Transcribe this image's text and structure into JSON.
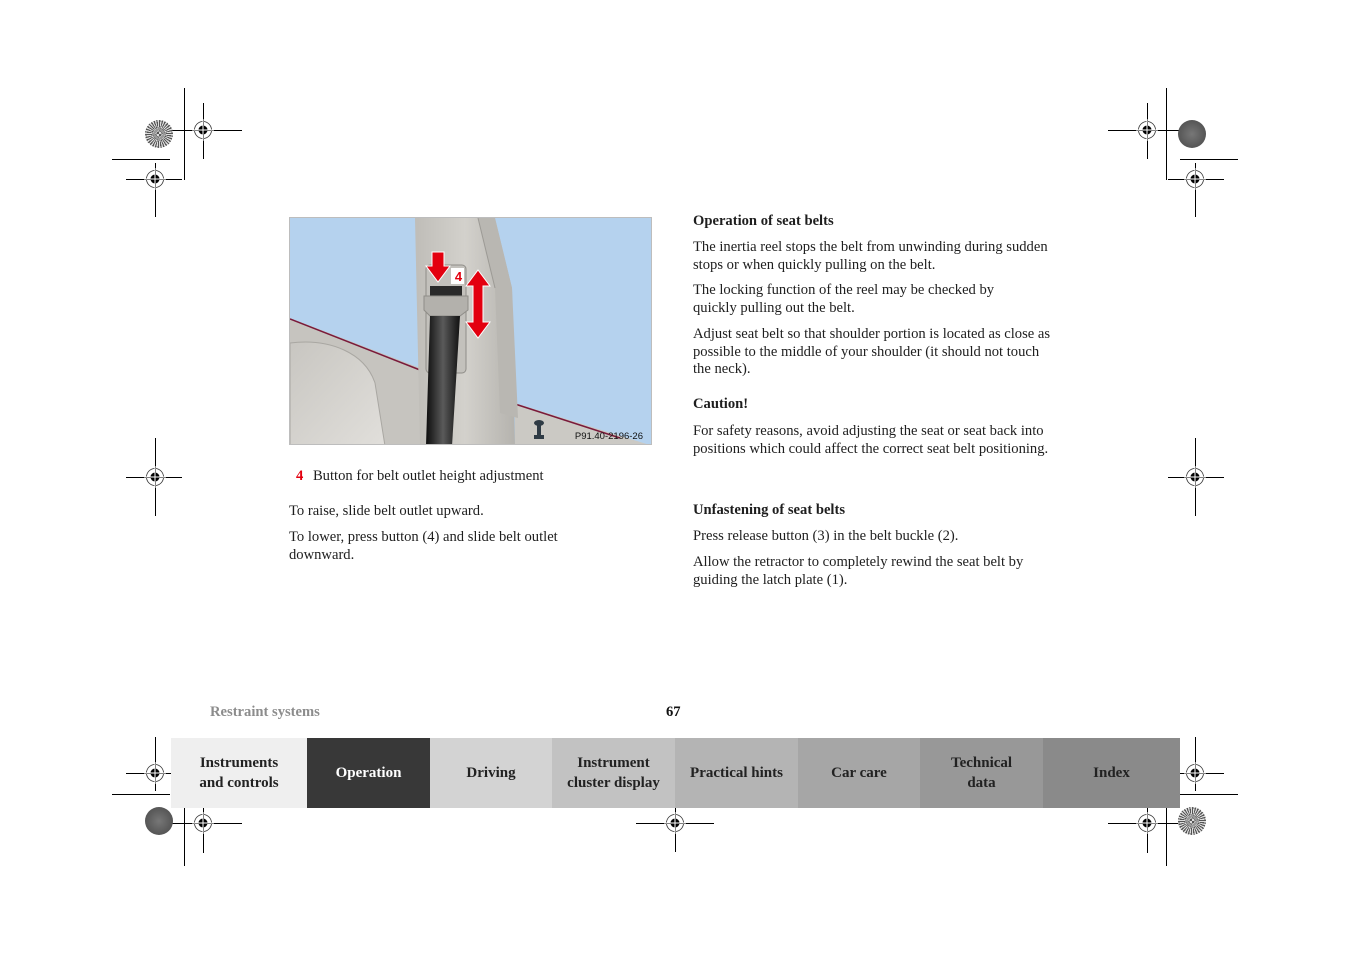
{
  "figure": {
    "callout_number": "4",
    "image_code": "P91.40-2196-26",
    "colors": {
      "sky": "#b5d2ee",
      "pillar": "#c9c7c2",
      "arrow": "#e3000f",
      "belt": "#151515"
    }
  },
  "left_column": {
    "legend": {
      "number": "4",
      "text": "Button for belt outlet height adjustment"
    },
    "paragraphs": [
      "To raise, slide belt outlet upward.",
      "To lower, press button (4) and slide belt outlet downward."
    ]
  },
  "right_column": {
    "section1": {
      "heading": "Operation of seat belts",
      "paragraphs": [
        "The inertia reel stops the belt from unwinding during sudden stops or when quickly pulling on the belt.",
        "The locking function of the reel may be checked by quickly pulling out the belt.",
        "Adjust seat belt so that shoulder portion is located as close as possible to the middle of your shoulder (it should not touch the neck)."
      ]
    },
    "caution": {
      "heading": "Caution!",
      "text": "For safety reasons, avoid adjusting the seat or seat back into positions which could affect the correct seat belt positioning."
    },
    "section2": {
      "heading": "Unfastening of seat belts",
      "paragraphs": [
        "Press release button (3) in the belt buckle (2).",
        "Allow the retractor to completely rewind the seat belt by guiding the latch plate (1)."
      ]
    }
  },
  "footer": {
    "section_title": "Restraint systems",
    "page_number": "67"
  },
  "nav_tabs": [
    {
      "line1": "Instruments",
      "line2": "and controls",
      "bg": "#efefef",
      "fg": "#222222"
    },
    {
      "line1": "Operation",
      "line2": "",
      "bg": "#383838",
      "fg": "#ffffff",
      "active": true
    },
    {
      "line1": "Driving",
      "line2": "",
      "bg": "#d3d3d3",
      "fg": "#222222"
    },
    {
      "line1": "Instrument",
      "line2": "cluster display",
      "bg": "#c2c2c2",
      "fg": "#222222"
    },
    {
      "line1": "Practical hints",
      "line2": "",
      "bg": "#b4b4b4",
      "fg": "#222222"
    },
    {
      "line1": "Car care",
      "line2": "",
      "bg": "#a6a6a6",
      "fg": "#222222"
    },
    {
      "line1": "Technical",
      "line2": "data",
      "bg": "#989898",
      "fg": "#222222"
    },
    {
      "line1": "Index",
      "line2": "",
      "bg": "#8a8a8a",
      "fg": "#222222"
    }
  ]
}
